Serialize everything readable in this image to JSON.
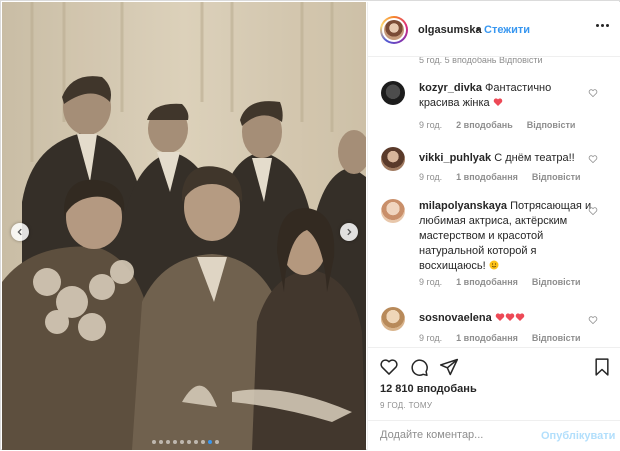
{
  "post": {
    "username": "olgasumska",
    "separator": "•",
    "follow_label": "Стежити",
    "partial_meta": "5 год.   5 вподобань   Відповісти"
  },
  "comments": [
    {
      "username": "kozyr_divka",
      "text": "Фантастично красива жінка",
      "emoji": "heart-icon",
      "time": "9 год.",
      "likes": "2 вподобань",
      "reply": "Відповісти"
    },
    {
      "username": "vikki_puhlyak",
      "text": "С днём театра!!",
      "time": "9 год.",
      "likes": "1 вподобання",
      "reply": "Відповісти"
    },
    {
      "username": "milapolyanskaya",
      "text": "Потрясающая и любимая актриса, актёрским мастерством и красотой натуральной которой я восхищаюсь!",
      "emoji": "smiling-face-icon",
      "time": "9 год.",
      "likes": "1 вподобання",
      "reply": "Відповісти"
    },
    {
      "username": "sosnovaelena",
      "text": "",
      "emoji": "three-hearts-icon",
      "time": "9 год.",
      "likes": "1 вподобання",
      "reply": "Відповісти"
    }
  ],
  "actions": {
    "likes": "12 810 вподобань",
    "time": "9 ГОД. ТОМУ"
  },
  "composer": {
    "placeholder": "Додайте коментар...",
    "publish_label": "Опублікувати"
  },
  "carousel": {
    "total": 10,
    "active_index": 8
  },
  "colors": {
    "accent": "#3897f0",
    "publish_disabled": "#b2dffc",
    "heart_red": "#ed4956",
    "muted": "#8e8e8e"
  }
}
